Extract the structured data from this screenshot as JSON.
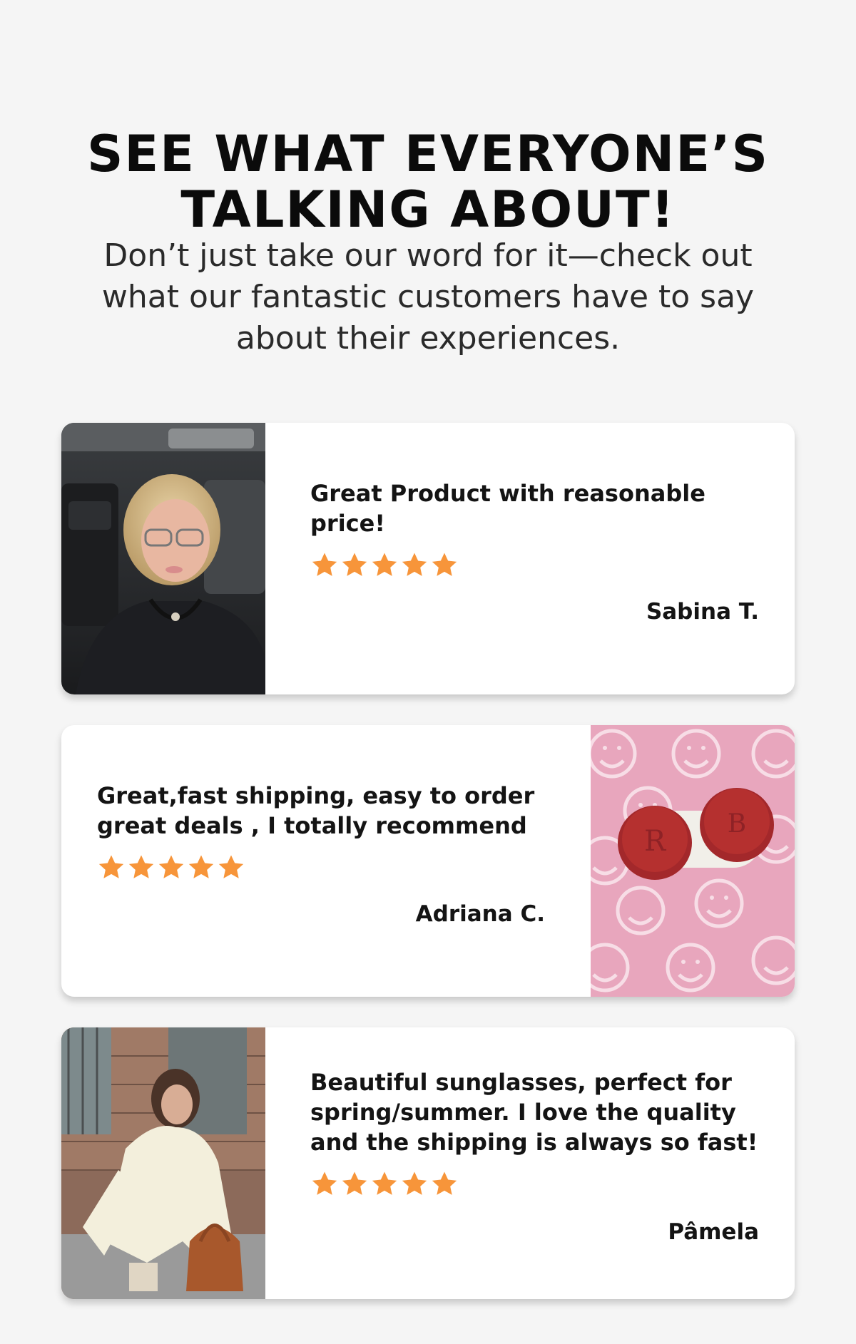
{
  "header": {
    "title_line1": "SEE WHAT EVERYONE’S",
    "title_line2": "TALKING ABOUT!",
    "subtitle_line1": "Don’t just take our word for it—check out",
    "subtitle_line2": "what our fantastic customers have to say",
    "subtitle_line3": "about their experiences."
  },
  "colors": {
    "background": "#f5f5f5",
    "card": "#ffffff",
    "star": "#f7953a",
    "text": "#141414"
  },
  "reviews": [
    {
      "text_line1": "Great Product with reasonable",
      "text_line2": "price!",
      "rating": 5,
      "author": "Sabina T.",
      "photo_icon": "customer-selfie-in-car-photo"
    },
    {
      "text_line1": "Great,fast shipping, easy to order",
      "text_line2": "great deals , I totally recommend",
      "rating": 5,
      "author": "Adriana C.",
      "photo_icon": "contact-lens-case-on-smiley-pattern-photo"
    },
    {
      "text_line1": "Beautiful sunglasses, perfect for",
      "text_line2": "spring/summer. I love the quality",
      "text_line3": "and the shipping is always so fast!",
      "rating": 5,
      "author": "Pâmela",
      "photo_icon": "woman-in-cream-suit-with-bag-photo"
    }
  ]
}
